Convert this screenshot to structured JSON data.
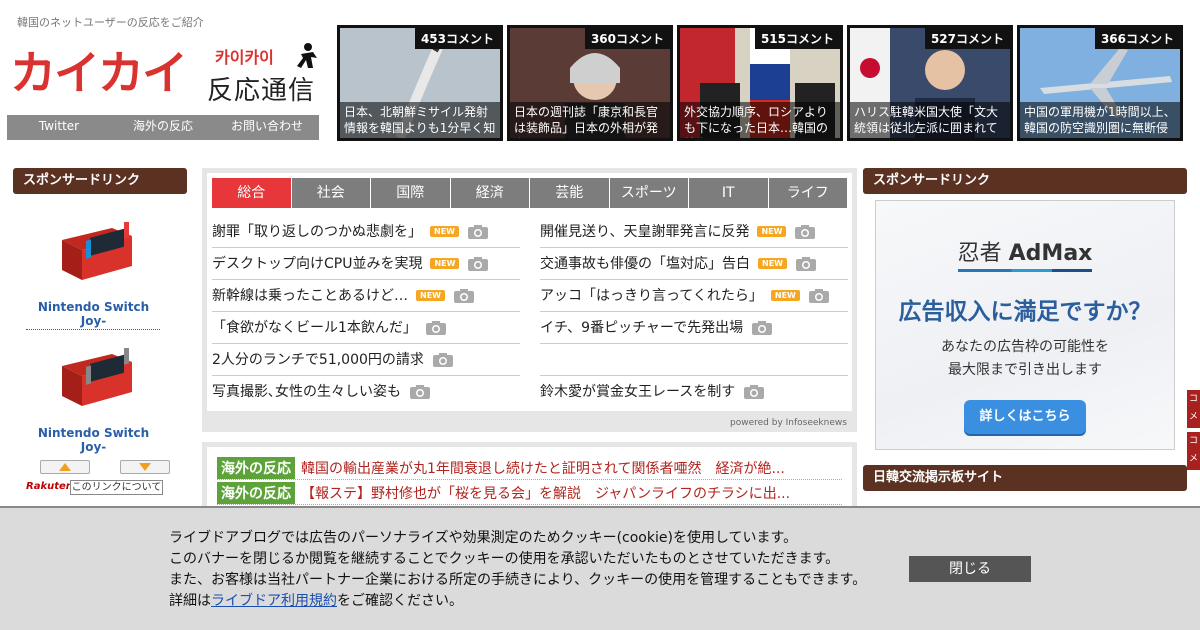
{
  "header": {
    "tagline": "韓国のネットユーザーの反応をご紹介",
    "logo_main": "カイカイ",
    "logo_kana": "카이카이",
    "logo_sub": "反応通信",
    "nav": [
      "Twitter",
      "海外の反応",
      "お問い合わせ"
    ]
  },
  "featured": [
    {
      "count": "453コメント",
      "caption": "日本、北朝鮮ミサイル発射情報を韓国よりも1分早く知ら"
    },
    {
      "count": "360コメント",
      "caption": "日本の週刊誌「康京和長官は装飾品」日本の外相が発言し"
    },
    {
      "count": "515コメント",
      "caption": "外交協力順序、ロシアよりも下になった日本…韓国の外交"
    },
    {
      "count": "527コメント",
      "caption": "ハリス駐韓米国大使「文大統領は従北左派に囲まれてい"
    },
    {
      "count": "366コメント",
      "caption": "中国の軍用機が1時間以上、韓国の防空識別圏に無断侵"
    }
  ],
  "left_sidebar": {
    "heading": "スポンサードリンク",
    "products": [
      {
        "name": "Nintendo Switch Joy-"
      },
      {
        "name": "Nintendo Switch Joy-"
      }
    ],
    "rakuten": "Rakuten",
    "about_link": "このリンクについて"
  },
  "news": {
    "tabs": [
      "総合",
      "社会",
      "国際",
      "経済",
      "芸能",
      "スポーツ",
      "IT",
      "ライフ"
    ],
    "new_label": "NEW",
    "left": [
      {
        "title": "謝罪「取り返しのつかぬ悲劇を」",
        "is_new": true
      },
      {
        "title": "デスクトップ向けCPU並みを実現",
        "is_new": true
      },
      {
        "title": "新幹線は乗ったことあるけど…",
        "is_new": true
      },
      {
        "title": "「食欲がなくビール1本飲んだ」",
        "is_new": false
      },
      {
        "title": "2人分のランチで51,000円の請求",
        "is_new": false
      },
      {
        "title": "写真撮影､女性の生々しい姿も",
        "is_new": false
      }
    ],
    "right": [
      {
        "title": "開催見送り、天皇謝罪発言に反発",
        "is_new": true
      },
      {
        "title": "交通事故も俳優の「塩対応」告白",
        "is_new": true
      },
      {
        "title": "アッコ「はっきり言ってくれたら」",
        "is_new": true
      },
      {
        "title": "イチ、9番ピッチャーで先発出場",
        "is_new": false
      },
      {
        "title": "",
        "is_new": false
      },
      {
        "title": "鈴木愛が賞金女王レースを制す",
        "is_new": false
      }
    ],
    "powered": "powered by Infoseeknews"
  },
  "reactions": [
    {
      "badge": "海外の反応",
      "text": "韓国の輸出産業が丸1年間衰退し続けたと証明されて関係者唖然　経済が絶..."
    },
    {
      "badge": "海外の反応",
      "text": "【報ステ】野村修也が「桜を見る会」を解説　ジャパンライフのチラシに出..."
    }
  ],
  "right_sidebar": {
    "heading": "スポンサードリンク",
    "ad": {
      "logo_a": "忍者",
      "logo_b": "AdMax",
      "headline": "広告収入に満足ですか？",
      "body1": "あなたの広告枠の可能性を",
      "body2": "最大限まで引き出します",
      "button": "詳しくはこちら"
    },
    "heading2": "日韓交流掲示板サイト",
    "edge_tabs": [
      "コメ",
      "コメ"
    ]
  },
  "cookie": {
    "line1": "ライブドアブログでは広告のパーソナライズや効果測定のためクッキー(cookie)を使用しています。",
    "line2": "このバナーを閉じるか閲覧を継続することでクッキーの使用を承認いただいたものとさせていただきます。",
    "line3": "また、お客様は当社パートナー企業における所定の手続きにより、クッキーの使用を管理することもできます。",
    "line4_pre": "詳細は",
    "line4_link": "ライブドア利用規約",
    "line4_post": "をご確認ください。",
    "close": "閉じる"
  },
  "colors": {
    "brand_red": "#d9322f",
    "tab_active": "#e8373a",
    "sidebar_head": "#5b3222",
    "reaction_green": "#5da33a"
  }
}
